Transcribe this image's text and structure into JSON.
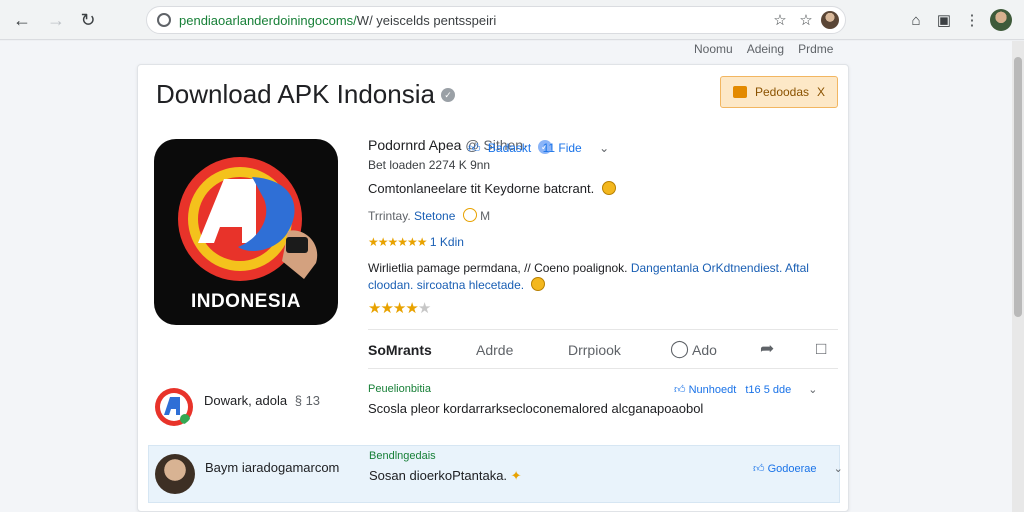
{
  "browser": {
    "url_host": "pendiaoarlanderdoiningocoms/",
    "url_path": "W/ yeiscelds pentsspeiri",
    "icons": [
      "back-arrow-icon",
      "forward-arrow-icon",
      "reload-icon",
      "lock-icon",
      "star-outline-icon",
      "bookmark-star-icon",
      "extensions-icon",
      "cast-icon",
      "menu-kebab-icon"
    ]
  },
  "top_links": [
    "Noomu",
    "Adeing",
    "Prdme"
  ],
  "page": {
    "title": "Download APK Indonsia",
    "download_chip": "Pedoodas",
    "download_chip_close": "X"
  },
  "app": {
    "icon_label": "INDONESIA",
    "name": "Podornrd Apea",
    "publisher": "@ Sithen·",
    "meta": "Bet loaden 2274 K 9nn",
    "tagline": "Comtonlaneelare tit Keydorne batcrant.",
    "category_prefix": "Trrintay.",
    "category_link": "Stetone",
    "category_suffix": "M",
    "rating_text": "1 Kdin",
    "desc_line1_a": "Wirlietlia pamage permdana,",
    "desc_line1_b": "// Coeno poalignok.",
    "desc_line1_link": "Dangentanla OrKdtnendiest. Aftal",
    "desc_line2_link": "cloodan. sircoatna hlecetade.",
    "rank_label": "Badaskt",
    "rank_value": "11 Fide",
    "stars_on": 4,
    "stars_total": 5
  },
  "tabs": [
    {
      "label": "SoMrants",
      "active": true
    },
    {
      "label": "Adrde",
      "active": false
    },
    {
      "label": "Drrpiook",
      "active": false
    },
    {
      "label": "Ado",
      "active": false
    }
  ],
  "list": [
    {
      "title": "Dowark, adola",
      "title_meta": "§ 13",
      "green": "Peuelionbitia",
      "text": "Scosla pleor kordarrarksecloconemalored alcganapoaobol",
      "right_label": "Nunhoedt",
      "right_value": "t16 5 dde"
    },
    {
      "title": "Baym iaradogamarcom",
      "green": "Bendlngedais",
      "text": "Sosan dioerkoPtantaka.",
      "right_label": "Godoerae"
    }
  ]
}
